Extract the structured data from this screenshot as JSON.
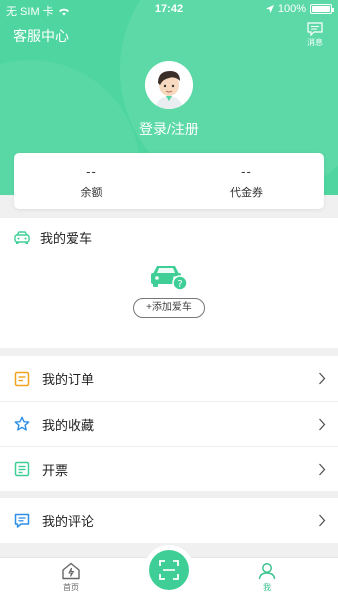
{
  "status_bar": {
    "carrier": "无 SIM 卡",
    "time": "17:42",
    "battery": "100%"
  },
  "header": {
    "customer_service": "客服中心",
    "messages_label": "消息",
    "login_label": "登录/注册"
  },
  "wallet": [
    {
      "value": "--",
      "label": "余额"
    },
    {
      "value": "--",
      "label": "代金券"
    }
  ],
  "my_car": {
    "title": "我的爱车",
    "add_car_label": "+添加爱车"
  },
  "menu_group1": [
    {
      "label": "我的订单",
      "icon": "order-icon",
      "color": "#f0a11e"
    },
    {
      "label": "我的收藏",
      "icon": "star-icon",
      "color": "#2f8fe8"
    },
    {
      "label": "开票",
      "icon": "invoice-icon",
      "color": "#3fcf96"
    }
  ],
  "menu_group2": [
    {
      "label": "我的评论",
      "icon": "comment-icon",
      "color": "#2f8fe8"
    }
  ],
  "tabbar": {
    "home_label": "首页",
    "me_label": "我"
  },
  "colors": {
    "brand": "#4fd6a0",
    "accent": "#3bc48e"
  }
}
